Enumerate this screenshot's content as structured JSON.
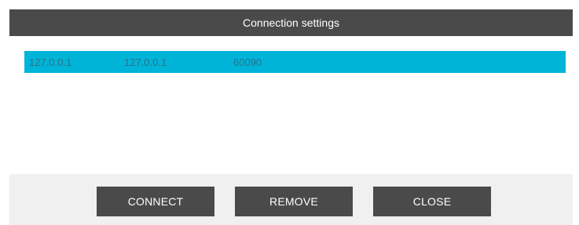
{
  "dialog": {
    "title": "Connection settings"
  },
  "connections": [
    {
      "address": "127.0.0.1",
      "host": "127.0.0.1",
      "port": "60090"
    }
  ],
  "buttons": {
    "connect": "CONNECT",
    "remove": "REMOVE",
    "close": "CLOSE"
  },
  "colors": {
    "titlebar": "#4a4a4a",
    "selected_row": "#00b4d8",
    "button": "#4a4a4a",
    "footer": "#f0f0f0"
  }
}
